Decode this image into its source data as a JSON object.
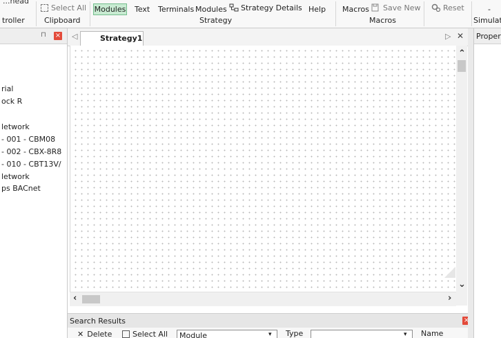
{
  "ribbon": {
    "top_cut_left": "...nead",
    "select_all": "Select All",
    "clipboard_group": "Clipboard",
    "controller_group_partial": "troller",
    "modules_btn": "Modules",
    "text_btn": "Text",
    "terminals_btn": "Terminals",
    "modules_btn2": "Modules",
    "strategy_details_btn": "Strategy Details",
    "help_btn": "Help",
    "strategy_group": "Strategy",
    "macros_btn": "Macros",
    "save_new_btn": "Save New",
    "macros_group": "Macros",
    "reset_btn": "Reset",
    "simulat_group_partial": "Simulat",
    "dash": "-"
  },
  "left_panel": {
    "items": [
      "rial",
      "ock R",
      "letwork",
      "- 001 - CBM08",
      "- 002 - CBX-8R8",
      "- 010 - CBT13V/",
      "letwork",
      "ps BACnet"
    ]
  },
  "tabs": {
    "active": "Strategy1"
  },
  "search": {
    "title": "Search Results",
    "delete_btn": "Delete",
    "select_all": "Select All",
    "module_dropdown": "Module",
    "type_label": "Type",
    "name_label": "Name"
  },
  "props": {
    "title": "Proper"
  },
  "colors": {
    "accent_green": "#c8ebd2",
    "close_red": "#e34a3a"
  }
}
